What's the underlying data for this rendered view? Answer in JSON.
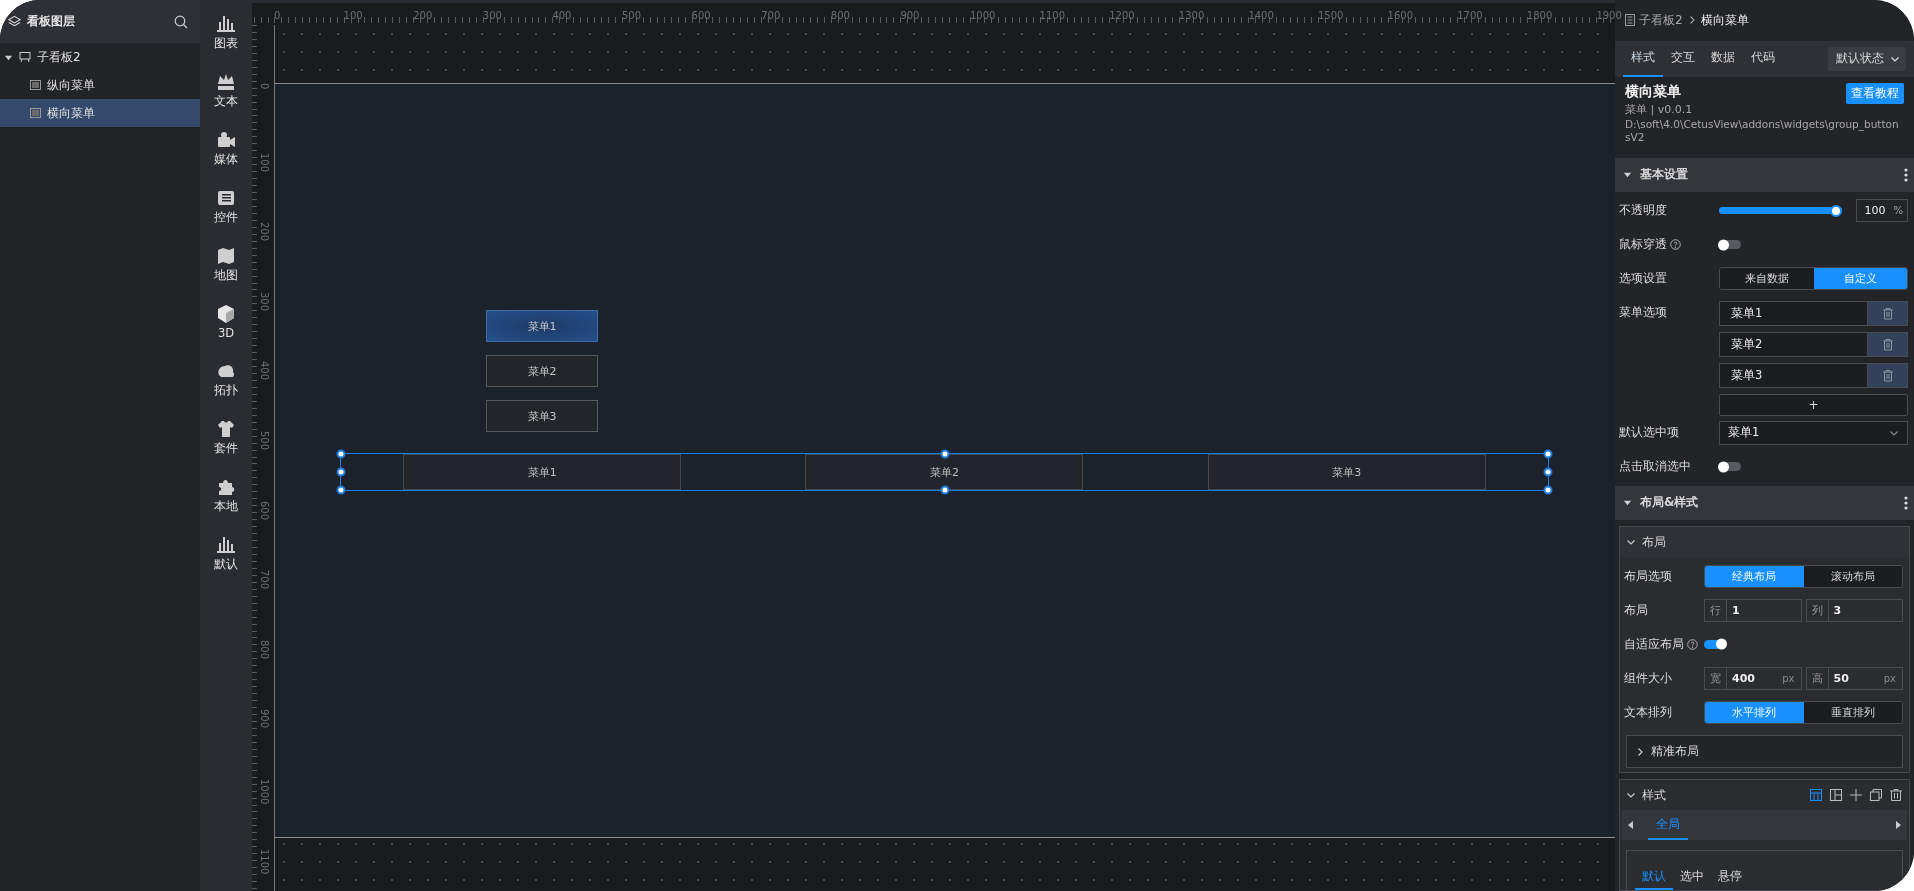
{
  "layers_panel": {
    "title": "看板图层",
    "tree": [
      {
        "label": "子看板2",
        "expanded": true,
        "selected": false,
        "children": [
          {
            "label": "纵向菜单",
            "selected": false
          },
          {
            "label": "横向菜单",
            "selected": true
          }
        ]
      }
    ]
  },
  "component_bar": [
    {
      "label": "图表"
    },
    {
      "label": "文本"
    },
    {
      "label": "媒体"
    },
    {
      "label": "控件"
    },
    {
      "label": "地图"
    },
    {
      "label": "3D"
    },
    {
      "label": "拓扑"
    },
    {
      "label": "套件"
    },
    {
      "label": "本地"
    },
    {
      "label": "默认"
    }
  ],
  "rulers": {
    "x_labels": [
      "0",
      "100",
      "200",
      "300",
      "400",
      "500",
      "600",
      "700",
      "800",
      "900",
      "1000",
      "1100",
      "1200",
      "1300",
      "1400",
      "1500",
      "1600",
      "1700",
      "1800",
      "1900"
    ],
    "y_labels": [
      "0",
      "100",
      "200",
      "300",
      "400",
      "500",
      "600",
      "700",
      "800",
      "900",
      "1000",
      "1100"
    ]
  },
  "canvas": {
    "vertical_menu": [
      {
        "label": "菜单1",
        "selected": true
      },
      {
        "label": "菜单2",
        "selected": false
      },
      {
        "label": "菜单3",
        "selected": false
      }
    ],
    "horizontal_menu": {
      "selected": true,
      "items": [
        {
          "label": "菜单1",
          "selected": false
        },
        {
          "label": "菜单2",
          "selected": false
        },
        {
          "label": "菜单3",
          "selected": false
        }
      ]
    }
  },
  "inspector": {
    "breadcrumb": [
      "子看板2",
      "横向菜单"
    ],
    "tabs": [
      {
        "label": "样式",
        "selected": true
      },
      {
        "label": "交互",
        "selected": false
      },
      {
        "label": "数据",
        "selected": false
      },
      {
        "label": "代码",
        "selected": false
      }
    ],
    "state_dropdown": "默认状态",
    "widget": {
      "title": "横向菜单",
      "subtitle": "菜单 | v0.0.1",
      "path": "D:\\soft\\4.0\\CetusView\\addons\\widgets\\group_buttonsV2",
      "tutorial_button": "查看教程"
    },
    "basic": {
      "title": "基本设置",
      "expanded": true,
      "rows": [
        {
          "kind": "slider",
          "label": "不透明度",
          "level": 1,
          "value": "100",
          "unit": "%"
        },
        {
          "kind": "toggle",
          "label": "鼠标穿透",
          "help": true,
          "on": false
        },
        {
          "kind": "segmented",
          "label": "选项设置",
          "options": [
            {
              "label": "来自数据",
              "selected": false
            },
            {
              "label": "自定义",
              "selected": true
            }
          ]
        },
        {
          "kind": "list",
          "label": "菜单选项",
          "items": [
            "菜单1",
            "菜单2",
            "菜单3"
          ],
          "add_button": "+"
        },
        {
          "kind": "select",
          "label": "默认选中项",
          "value": "菜单1"
        },
        {
          "kind": "toggle",
          "label": "点击取消选中",
          "help": false,
          "on": false
        }
      ]
    },
    "layout_style": {
      "title": "布局&样式",
      "expanded": true,
      "layout": {
        "title": "布局",
        "expanded": true,
        "rows": [
          {
            "kind": "segmented",
            "label": "布局选项",
            "options": [
              {
                "label": "经典布局",
                "selected": true
              },
              {
                "label": "滚动布局",
                "selected": false
              }
            ]
          },
          {
            "kind": "pair",
            "label": "布局",
            "fields": [
              {
                "prefix": "行",
                "value": "1"
              },
              {
                "prefix": "列",
                "value": "3"
              }
            ]
          },
          {
            "kind": "toggle",
            "label": "自适应布局",
            "help": true,
            "on": true
          },
          {
            "kind": "pair",
            "label": "组件大小",
            "fields": [
              {
                "prefix": "宽",
                "value": "400",
                "unit": "px"
              },
              {
                "prefix": "高",
                "value": "50",
                "unit": "px"
              }
            ]
          },
          {
            "kind": "segmented",
            "label": "文本排列",
            "options": [
              {
                "label": "水平排列",
                "selected": true
              },
              {
                "label": "垂直排列",
                "selected": false
              }
            ]
          }
        ],
        "precise": {
          "title": "精准布局",
          "expanded": false
        }
      },
      "style": {
        "title": "样式",
        "expanded": true,
        "tools": [
          {
            "selected": true
          },
          {
            "selected": false
          },
          {
            "selected": false
          },
          {
            "selected": false
          },
          {
            "selected": false
          }
        ],
        "tabs": [
          {
            "label": "全局",
            "selected": true
          }
        ],
        "inner_tabs": [
          {
            "label": "默认",
            "selected": true
          },
          {
            "label": "选中",
            "selected": false
          },
          {
            "label": "悬停",
            "selected": false
          }
        ]
      }
    }
  }
}
